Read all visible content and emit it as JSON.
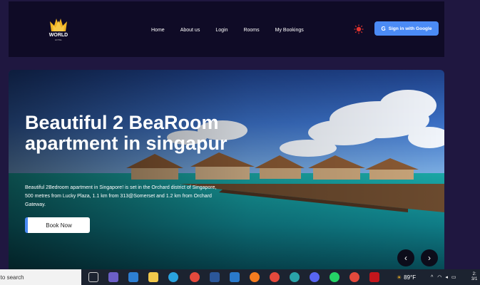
{
  "brand": {
    "name": "WORLD",
    "sub": "HOTEL"
  },
  "nav": {
    "items": [
      "Home",
      "About us",
      "Login",
      "Rooms",
      "My Bookings"
    ]
  },
  "auth": {
    "google_label": "Sign in with Google"
  },
  "hero": {
    "title": "Beautiful 2 BeaRoom apartment in singapur",
    "description": "Beautiful 2Bedroom apartment in Singapore! is set in the Orchard district of Singapore, 500 metres from Lucky Plaza, 1.1 km from 313@Somerset and 1.2 km from Orchard Gateway.",
    "cta": "Book Now",
    "prev_icon": "chevron-left-icon",
    "next_icon": "chevron-right-icon"
  },
  "taskbar": {
    "search_text": "e to search",
    "weather": "89°F",
    "clock_a": "2:",
    "clock_b": "3/1"
  },
  "colors": {
    "accent": "#4b8bf5",
    "navbar": "#0f0b26",
    "page_bg": "#1f1740",
    "sun": "#e3342f"
  }
}
